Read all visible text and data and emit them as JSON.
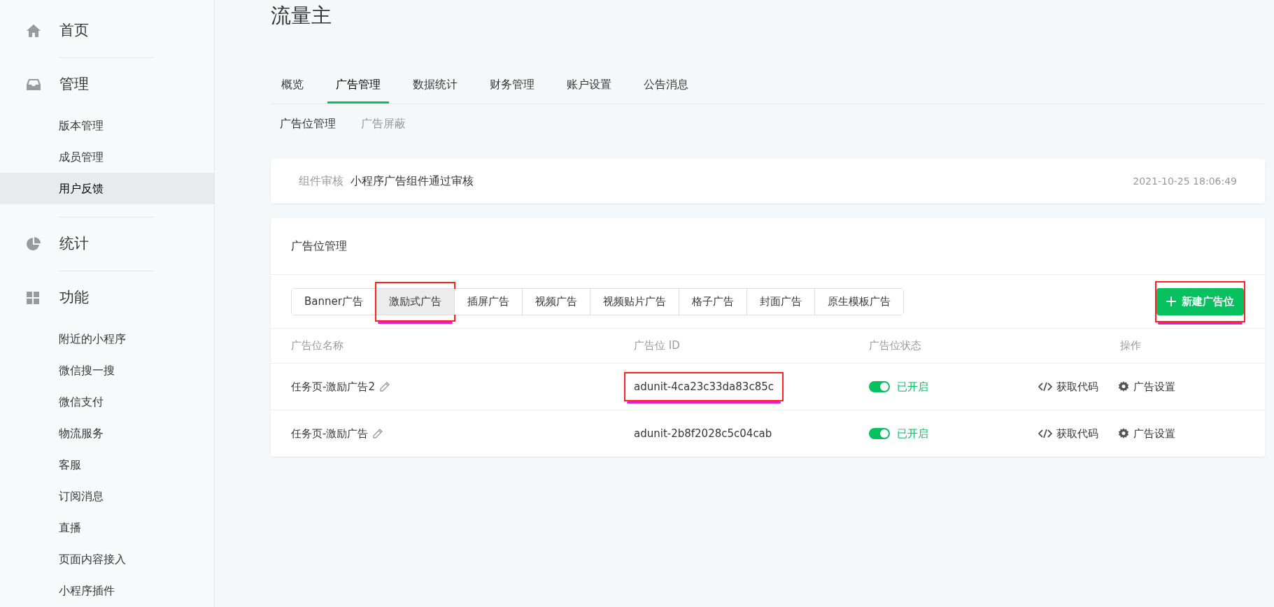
{
  "sidebar": {
    "sections": [
      {
        "label": "首页"
      },
      {
        "label": "管理",
        "items": [
          {
            "label": "版本管理",
            "selected": false
          },
          {
            "label": "成员管理",
            "selected": false
          },
          {
            "label": "用户反馈",
            "selected": true
          }
        ]
      },
      {
        "label": "统计"
      },
      {
        "label": "功能",
        "items": [
          {
            "label": "附近的小程序",
            "selected": false
          },
          {
            "label": "微信搜一搜",
            "selected": false
          },
          {
            "label": "微信支付",
            "selected": false
          },
          {
            "label": "物流服务",
            "selected": false
          },
          {
            "label": "客服",
            "selected": false
          },
          {
            "label": "订阅消息",
            "selected": false
          },
          {
            "label": "直播",
            "selected": false
          },
          {
            "label": "页面内容接入",
            "selected": false
          },
          {
            "label": "小程序插件",
            "selected": false
          }
        ]
      }
    ]
  },
  "page_title": "流量主",
  "tabs": [
    {
      "label": "概览",
      "selected": false
    },
    {
      "label": "广告管理",
      "selected": true
    },
    {
      "label": "数据统计",
      "selected": false
    },
    {
      "label": "财务管理",
      "selected": false
    },
    {
      "label": "账户设置",
      "selected": false
    },
    {
      "label": "公告消息",
      "selected": false
    }
  ],
  "sub_tabs": [
    {
      "label": "广告位管理",
      "selected": true
    },
    {
      "label": "广告屏蔽",
      "selected": false
    }
  ],
  "notice": {
    "label": "组件审核",
    "text": "小程序广告组件通过审核",
    "time": "2021-10-25 18:06:49"
  },
  "card": {
    "title": "广告位管理",
    "ad_types": [
      {
        "label": "Banner广告",
        "selected": false,
        "highlighted": false
      },
      {
        "label": "激励式广告",
        "selected": true,
        "highlighted": true
      },
      {
        "label": "插屏广告",
        "selected": false,
        "highlighted": false
      },
      {
        "label": "视频广告",
        "selected": false,
        "highlighted": false
      },
      {
        "label": "视频贴片广告",
        "selected": false,
        "highlighted": false
      },
      {
        "label": "格子广告",
        "selected": false,
        "highlighted": false
      },
      {
        "label": "封面广告",
        "selected": false,
        "highlighted": false
      },
      {
        "label": "原生模板广告",
        "selected": false,
        "highlighted": false
      }
    ],
    "new_button": {
      "label": "新建广告位",
      "highlighted": true
    },
    "columns": [
      "广告位名称",
      "广告位 ID",
      "广告位状态",
      "操作"
    ],
    "rows": [
      {
        "name": "任务页-激励广告2",
        "id": "adunit-4ca23c33da83c85c",
        "id_highlighted": true,
        "on": true,
        "status": "已开启",
        "actions": [
          "获取代码",
          "广告设置"
        ]
      },
      {
        "name": "任务页-激励广告",
        "id": "adunit-2b8f2028c5c04cab",
        "id_highlighted": false,
        "on": true,
        "status": "已开启",
        "actions": [
          "获取代码",
          "广告设置"
        ]
      }
    ]
  }
}
